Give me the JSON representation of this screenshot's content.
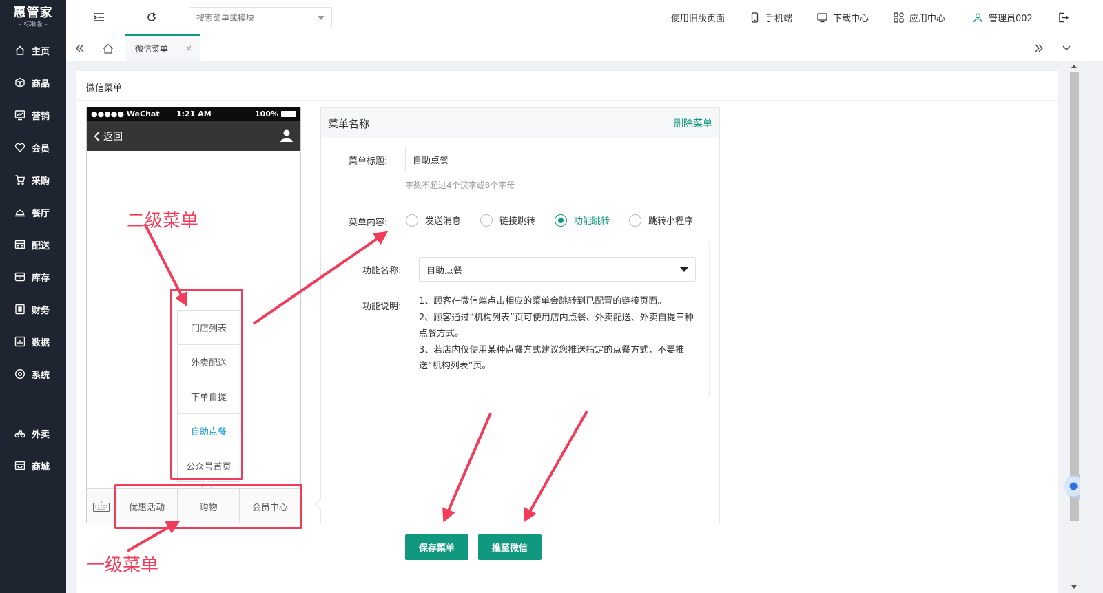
{
  "logo": {
    "brand": "惠管家",
    "edition": "标准版"
  },
  "sidebar": {
    "items": [
      {
        "label": "主页",
        "icon": "home-icon"
      },
      {
        "label": "商品",
        "icon": "box-icon"
      },
      {
        "label": "营销",
        "icon": "chart-icon"
      },
      {
        "label": "会员",
        "icon": "heart-icon"
      },
      {
        "label": "采购",
        "icon": "cart-icon"
      },
      {
        "label": "餐厅",
        "icon": "tray-icon"
      },
      {
        "label": "配送",
        "icon": "truck-icon"
      },
      {
        "label": "库存",
        "icon": "storage-icon"
      },
      {
        "label": "财务",
        "icon": "finance-icon"
      },
      {
        "label": "数据",
        "icon": "data-icon"
      },
      {
        "label": "系统",
        "icon": "settings-icon"
      },
      {
        "label": "外卖",
        "icon": "bike-icon"
      },
      {
        "label": "商城",
        "icon": "shop-icon"
      }
    ]
  },
  "topbar": {
    "search_placeholder": "搜索菜单或模块",
    "old_version": "使用旧版页面",
    "mobile": "手机端",
    "download": "下载中心",
    "apps": "应用中心",
    "user": "管理员002"
  },
  "tabs": {
    "active": "微信菜单",
    "close": "×"
  },
  "card": {
    "title": "微信菜单"
  },
  "phone": {
    "carrier": "●●●●● WeChat",
    "time": "1:21 AM",
    "battery": "100%",
    "back": "返回",
    "submenu": [
      "门店列表",
      "外卖配送",
      "下单自提",
      "自助点餐",
      "公众号首页"
    ],
    "submenu_active_index": 3,
    "bottom_menu": [
      "优惠活动",
      "购物",
      "会员中心"
    ]
  },
  "annotations": {
    "level2": "二级菜单",
    "level1": "一级菜单"
  },
  "editor": {
    "header_title": "菜单名称",
    "delete": "删除菜单",
    "title_label": "菜单标题:",
    "title_value": "自助点餐",
    "hint": "字数不超过4个汉字或8个字母",
    "content_label": "菜单内容:",
    "options": [
      "发送消息",
      "链接跳转",
      "功能跳转",
      "跳转小程序"
    ],
    "selected_option": "功能跳转",
    "func_name_label": "功能名称:",
    "func_name_value": "自助点餐",
    "func_desc_label": "功能说明:",
    "func_desc": [
      "1、顾客在微信端点击相应的菜单会跳转到已配置的链接页面。",
      "2、顾客通过“机构列表”页可使用店内点餐、外卖配送、外卖自提三种点餐方式。",
      "3、若店内仅使用某种点餐方式建议您推送指定的点餐方式，不要推送“机构列表”页。"
    ]
  },
  "buttons": {
    "save": "保存菜单",
    "push": "推至微信"
  },
  "colors": {
    "sidebar_bg": "#1f2530",
    "accent": "#10997f",
    "annotation": "#f23c5a",
    "submenu_active": "#1a9bd7"
  }
}
